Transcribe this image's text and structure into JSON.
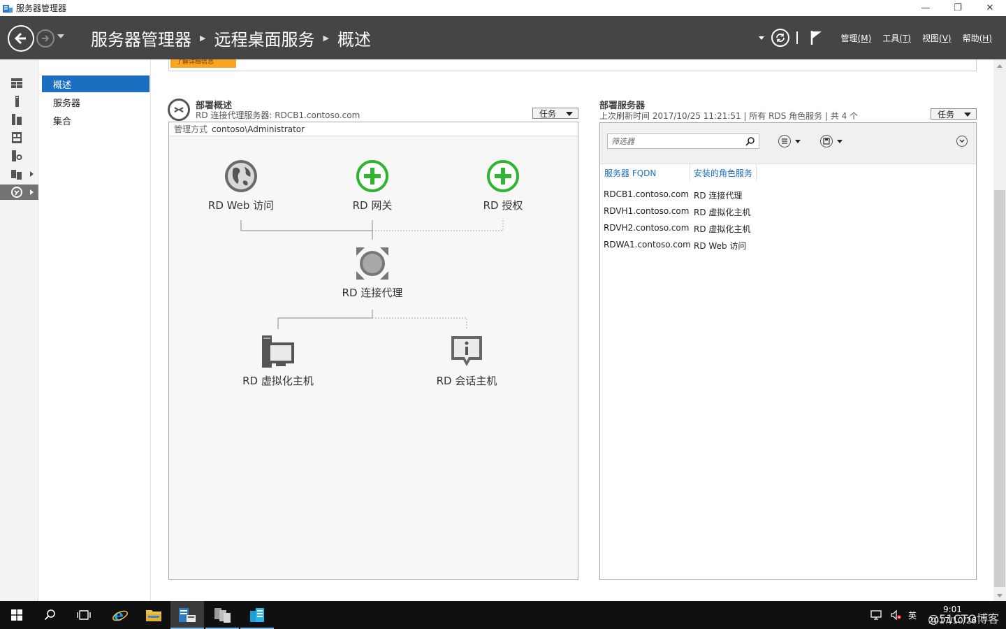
{
  "window": {
    "title": "服务器管理器",
    "minimize": "—",
    "restore": "❐",
    "close": "✕"
  },
  "header": {
    "breadcrumb": [
      "服务器管理器",
      "远程桌面服务",
      "概述"
    ],
    "menu": [
      {
        "label": "管理",
        "key": "(M)"
      },
      {
        "label": "工具",
        "key": "(T)"
      },
      {
        "label": "视图",
        "key": "(V)"
      },
      {
        "label": "帮助",
        "key": "(H)"
      }
    ]
  },
  "subnav": {
    "items": [
      "概述",
      "服务器",
      "集合"
    ]
  },
  "top_strip": {
    "tag": "了解详细信息"
  },
  "deployment_overview": {
    "title": "部署概述",
    "subtitle": "RD 连接代理服务器: RDCB1.contoso.com",
    "task_label": "任务",
    "manage_label": "管理方式",
    "manage_value": "contoso\\Administrator",
    "nodes": {
      "web": "RD Web 访问",
      "gateway": "RD 网关",
      "licensing": "RD 授权",
      "broker": "RD 连接代理",
      "virt": "RD 虚拟化主机",
      "session": "RD 会话主机"
    }
  },
  "deployment_servers": {
    "title": "部署服务器",
    "subtitle": "上次刷新时间 2017/10/25 11:21:51 | 所有 RDS 角色服务 | 共 4 个",
    "task_label": "任务",
    "filter_placeholder": "筛选器",
    "columns": [
      "服务器 FQDN",
      "安装的角色服务"
    ],
    "rows": [
      [
        "RDCB1.contoso.com",
        "RD 连接代理"
      ],
      [
        "RDVH1.contoso.com",
        "RD 虚拟化主机"
      ],
      [
        "RDVH2.contoso.com",
        "RD 虚拟化主机"
      ],
      [
        "RDWA1.contoso.com",
        "RD Web 访问"
      ]
    ]
  },
  "taskbar": {
    "ime": "英",
    "time": "9:01",
    "date": "2017/10/26",
    "watermark": "@51CTO博客"
  },
  "colors": {
    "header_bg": "#454545",
    "accent_blue": "#1a6fc0",
    "add_green": "#2fb52f",
    "orange_tag": "#f8a524"
  }
}
